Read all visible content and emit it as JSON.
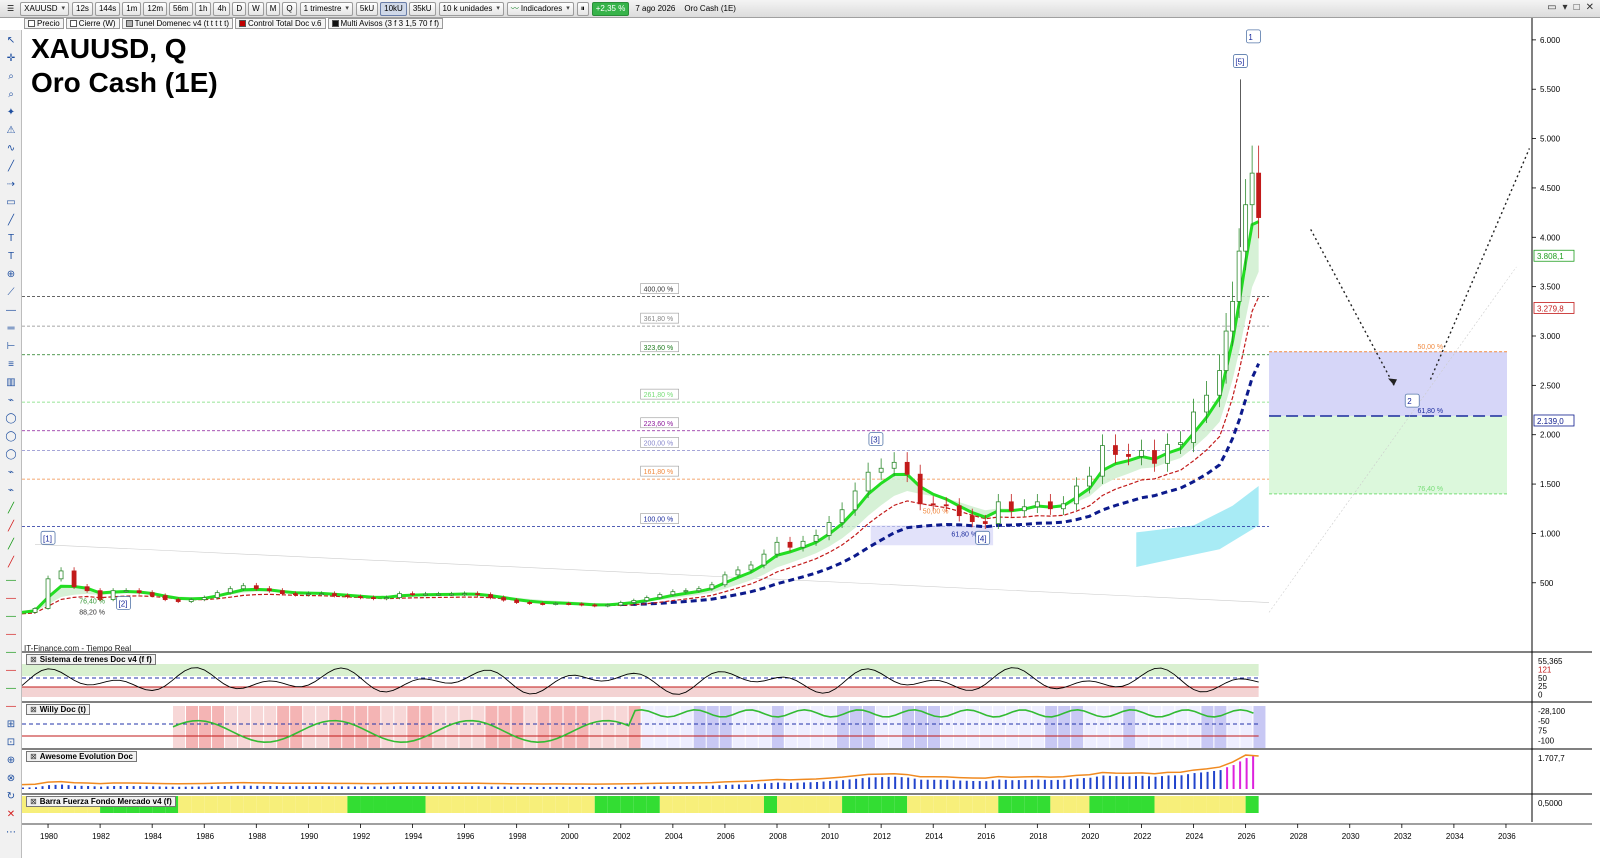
{
  "toolbar": {
    "symbol": "XAUUSD",
    "timeframes": [
      "12s",
      "144s",
      "1m",
      "12m",
      "56m",
      "1h",
      "4h",
      "D",
      "W",
      "M",
      "Q"
    ],
    "period": "1 trimestre",
    "units": [
      "5kU",
      "10kU",
      "35kU"
    ],
    "units_selected": "10kU",
    "units_dropdown": "10 k unidades",
    "indicators": "Indicadores",
    "change": "+2,35 %",
    "date": "7 ago 2026",
    "instrument": "Oro Cash (1E)"
  },
  "legend": [
    {
      "label": "Precio",
      "color": "#ffffff"
    },
    {
      "label": "Cierre (W)",
      "color": "#ffffff"
    },
    {
      "label": "Tunel Domenec v4 (t t t t t)",
      "color": "#b0b0b0"
    },
    {
      "label": "Control Total Doc v.6",
      "color": "#c00000"
    },
    {
      "label": "Multi Avisos (3 f 3 1,5 70 f f)",
      "color": "#111111"
    }
  ],
  "title": {
    "line1": "XAUUSD, Q",
    "line2": "Oro Cash (1E)"
  },
  "source": "IT-Finance.com - Tiempo Real",
  "panels": [
    {
      "label": "Sistema de trenes Doc v4 (f f)",
      "right_values": [
        "55,365",
        "121",
        "50",
        "25",
        "0"
      ]
    },
    {
      "label": "Willy Doc (t)",
      "right_values": [
        "-28,100",
        "-50",
        "75",
        "-100"
      ]
    },
    {
      "label": "Awesome Evolution Doc",
      "right_values": [
        "1.707,7"
      ]
    },
    {
      "label": "Barra Fuerza Fondo Mercado v4 (f)",
      "right_values": [
        "0,5000"
      ]
    }
  ],
  "colors": {
    "ema_green": "#22dd22",
    "dashed_blue": "#0c1a8c",
    "red_line": "#c21a1a",
    "up_candle": "#2d8a2d",
    "down_candle": "#c21a1a",
    "cyan_zone": "#9fe9f4",
    "purple_zone": "#d6d6f8",
    "green_zone": "#dcf8dc"
  },
  "chart_data": {
    "type": "candlestick",
    "x_axis": {
      "ticks": [
        "1980",
        "1982",
        "1984",
        "1986",
        "1988",
        "1990",
        "1992",
        "1994",
        "1996",
        "1998",
        "2000",
        "2002",
        "2004",
        "2006",
        "2008",
        "2010",
        "2012",
        "2014",
        "2016",
        "2018",
        "2020",
        "2022",
        "2024",
        "2026",
        "2028",
        "2030",
        "2032",
        "2034",
        "2036"
      ],
      "range": [
        1979.0,
        2037.0
      ]
    },
    "y_axis": {
      "ticks": [
        500,
        1000,
        1500,
        2000,
        2500,
        3000,
        3500,
        4000,
        4500,
        5000,
        5500,
        6000
      ],
      "tick_labels": [
        "500",
        "1.000",
        "1.500",
        "2.000",
        "2.500",
        "3.000",
        "3.500",
        "4.000",
        "4.500",
        "5.000",
        "5.500",
        "6.000"
      ],
      "range": [
        -100,
        6100
      ]
    },
    "price_labels": [
      {
        "value": 3808,
        "text": "3.808,1",
        "color": "#1f9e1f"
      },
      {
        "value": 3279,
        "text": "3.279,8",
        "color": "#c21a1a"
      },
      {
        "value": 2139,
        "text": "2.139,0",
        "color": "#0c1a8c"
      }
    ],
    "price_path": [
      [
        1979.0,
        200
      ],
      [
        1979.5,
        240
      ],
      [
        1980.0,
        540
      ],
      [
        1980.5,
        620
      ],
      [
        1981.0,
        460
      ],
      [
        1981.5,
        420
      ],
      [
        1982.0,
        330
      ],
      [
        1982.5,
        420
      ],
      [
        1983.0,
        420
      ],
      [
        1983.5,
        400
      ],
      [
        1984.0,
        370
      ],
      [
        1984.5,
        330
      ],
      [
        1985.0,
        310
      ],
      [
        1985.5,
        330
      ],
      [
        1986.0,
        350
      ],
      [
        1986.5,
        400
      ],
      [
        1987.0,
        440
      ],
      [
        1987.5,
        470
      ],
      [
        1988.0,
        440
      ],
      [
        1988.5,
        420
      ],
      [
        1989.0,
        390
      ],
      [
        1989.5,
        380
      ],
      [
        1990.0,
        390
      ],
      [
        1990.5,
        390
      ],
      [
        1991.0,
        370
      ],
      [
        1991.5,
        360
      ],
      [
        1992.0,
        350
      ],
      [
        1992.5,
        340
      ],
      [
        1993.0,
        350
      ],
      [
        1993.5,
        390
      ],
      [
        1994.0,
        385
      ],
      [
        1994.5,
        385
      ],
      [
        1995.0,
        385
      ],
      [
        1995.5,
        385
      ],
      [
        1996.0,
        390
      ],
      [
        1996.5,
        380
      ],
      [
        1997.0,
        350
      ],
      [
        1997.5,
        325
      ],
      [
        1998.0,
        300
      ],
      [
        1998.5,
        290
      ],
      [
        1999.0,
        285
      ],
      [
        1999.5,
        290
      ],
      [
        2000.0,
        285
      ],
      [
        2000.5,
        275
      ],
      [
        2001.0,
        265
      ],
      [
        2001.5,
        275
      ],
      [
        2002.0,
        300
      ],
      [
        2002.5,
        320
      ],
      [
        2003.0,
        350
      ],
      [
        2003.5,
        380
      ],
      [
        2004.0,
        410
      ],
      [
        2004.5,
        420
      ],
      [
        2005.0,
        440
      ],
      [
        2005.5,
        480
      ],
      [
        2006.0,
        580
      ],
      [
        2006.5,
        630
      ],
      [
        2007.0,
        680
      ],
      [
        2007.5,
        790
      ],
      [
        2008.0,
        910
      ],
      [
        2008.5,
        860
      ],
      [
        2009.0,
        920
      ],
      [
        2009.5,
        980
      ],
      [
        2010.0,
        1110
      ],
      [
        2010.5,
        1240
      ],
      [
        2011.0,
        1430
      ],
      [
        2011.5,
        1620
      ],
      [
        2012.0,
        1660
      ],
      [
        2012.5,
        1720
      ],
      [
        2013.0,
        1600
      ],
      [
        2013.5,
        1300
      ],
      [
        2014.0,
        1290
      ],
      [
        2014.5,
        1280
      ],
      [
        2015.0,
        1180
      ],
      [
        2015.5,
        1120
      ],
      [
        2016.0,
        1100
      ],
      [
        2016.5,
        1320
      ],
      [
        2017.0,
        1230
      ],
      [
        2017.5,
        1270
      ],
      [
        2018.0,
        1320
      ],
      [
        2018.5,
        1250
      ],
      [
        2019.0,
        1300
      ],
      [
        2019.5,
        1480
      ],
      [
        2020.0,
        1580
      ],
      [
        2020.5,
        1890
      ],
      [
        2021.0,
        1800
      ],
      [
        2021.5,
        1780
      ],
      [
        2022.0,
        1840
      ],
      [
        2022.5,
        1710
      ],
      [
        2023.0,
        1900
      ],
      [
        2023.5,
        1920
      ],
      [
        2024.0,
        2230
      ],
      [
        2024.5,
        2400
      ],
      [
        2025.0,
        2650
      ],
      [
        2025.25,
        3050
      ],
      [
        2025.5,
        3350
      ],
      [
        2025.75,
        3860
      ],
      [
        2026.0,
        4330
      ],
      [
        2026.25,
        4650
      ],
      [
        2026.5,
        4200
      ]
    ],
    "fib_levels": [
      {
        "pct": "400,00 %",
        "price": 3400,
        "color": "#333333"
      },
      {
        "pct": "361,80 %",
        "price": 3100,
        "color": "#888888"
      },
      {
        "pct": "323,60 %",
        "price": 2810,
        "color": "#1c7a1c"
      },
      {
        "pct": "261,80 %",
        "price": 2330,
        "color": "#77dd77"
      },
      {
        "pct": "223,60 %",
        "price": 2040,
        "color": "#8b1a9b"
      },
      {
        "pct": "200,00 %",
        "price": 1840,
        "color": "#8888cc"
      },
      {
        "pct": "161,80 %",
        "price": 1550,
        "color": "#f08a40"
      },
      {
        "pct": "100,00 %",
        "price": 1070,
        "color": "#1a2a9c"
      }
    ],
    "retracement_levels": [
      {
        "pct": "50,00 %",
        "price": 2840,
        "color": "#f08a40"
      },
      {
        "pct": "61,80 %",
        "price": 2190,
        "color": "#1a2a9c"
      },
      {
        "pct": "76,40 %",
        "price": 1400,
        "color": "#77dd77"
      }
    ],
    "small_labels": [
      {
        "text": "76,40 %",
        "x": 1981.2,
        "price": 290,
        "color": "#3a9a3a"
      },
      {
        "text": "88,20 %",
        "x": 1981.2,
        "price": 180,
        "color": "#333333"
      },
      {
        "text": "50,00 %",
        "x": 2013.6,
        "price": 1200,
        "color": "#f08a40"
      },
      {
        "text": "61,80 %",
        "x": 2014.7,
        "price": 970,
        "color": "#1a2a9c"
      }
    ],
    "wave_labels": [
      {
        "text": "[1]",
        "x": 1980.0,
        "price": 920
      },
      {
        "text": "[2]",
        "x": 1982.9,
        "price": 260
      },
      {
        "text": "[3]",
        "x": 2011.8,
        "price": 1920
      },
      {
        "text": "[4]",
        "x": 2015.9,
        "price": 920
      },
      {
        "text": "[5]",
        "x": 2025.8,
        "price": 5750
      },
      {
        "text": "1",
        "x": 2026.3,
        "price": 6000
      },
      {
        "text": "2",
        "x": 2032.4,
        "price": 2310
      }
    ]
  }
}
